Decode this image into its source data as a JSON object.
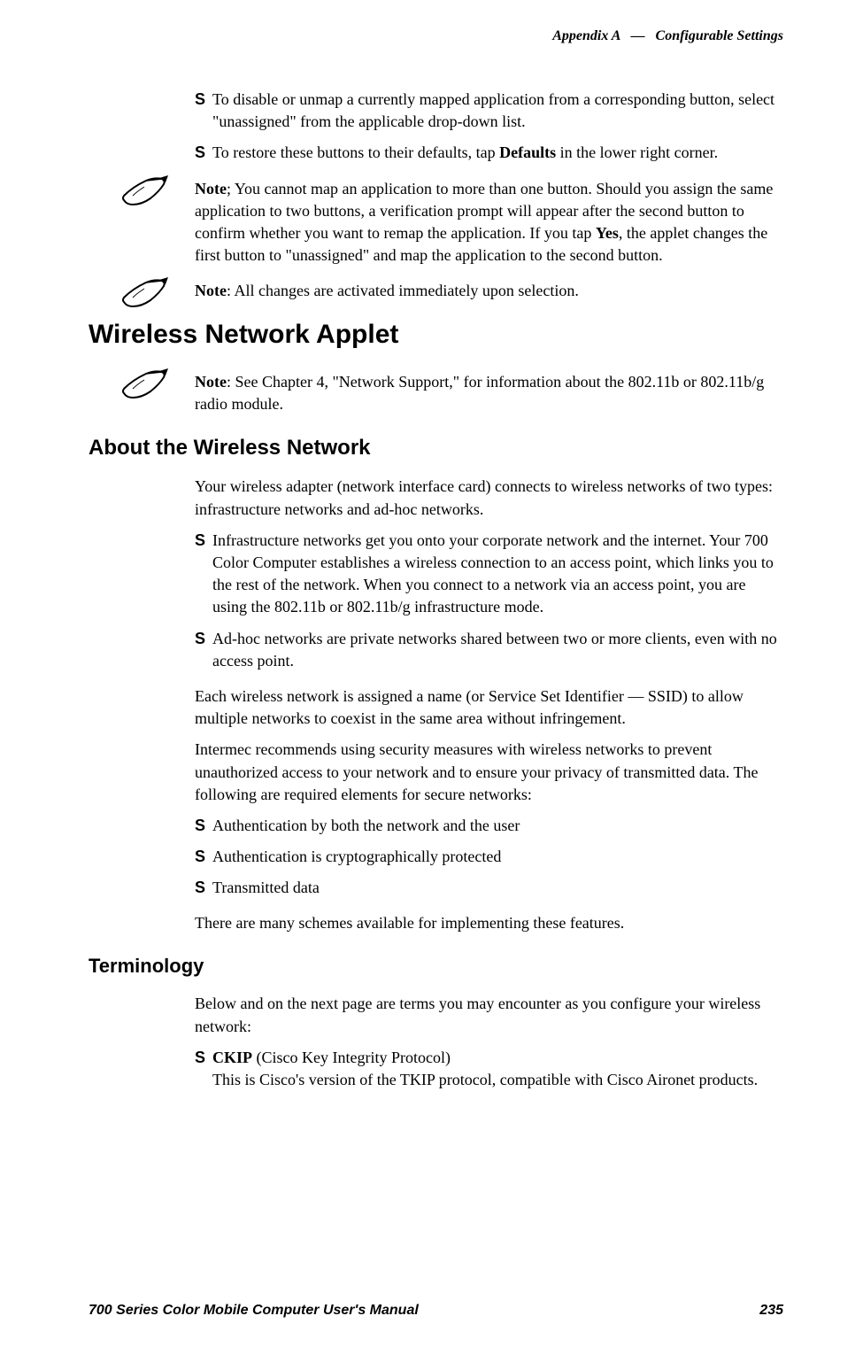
{
  "header": {
    "appendix": "Appendix A",
    "dash": "—",
    "title": "Configurable Settings"
  },
  "bullet1": "To disable or unmap a currently mapped application from a corresponding button, select \"unassigned\" from the applicable drop-down list.",
  "bullet2_before": "To restore these buttons to their defaults, tap ",
  "bullet2_bold": "Defaults",
  "bullet2_after": " in the lower right corner.",
  "note1_label": "Note",
  "note1_text": "; You cannot map an application to more than one button. Should you assign the same application to two buttons, a verification prompt will appear after the second button to confirm whether you want to remap the application. If you tap ",
  "note1_bold": "Yes",
  "note1_after": ", the applet changes the first button to \"unassigned\" and map the application to the second button.",
  "note2_label": "Note",
  "note2_text": ": All changes are activated immediately upon selection.",
  "h1": "Wireless Network Applet",
  "note3_label": "Note",
  "note3_text": ": See Chapter 4, \"Network Support,\" for information about the 802.11b or 802.11b/g radio module.",
  "h2": "About the Wireless Network",
  "p1": "Your wireless adapter (network interface card) connects to wireless networks of two types: infrastructure networks and ad-hoc networks.",
  "bullet3": "Infrastructure networks get you onto your corporate network and the internet. Your 700 Color Computer establishes a wireless connection to an access point, which links you to the rest of the network. When you connect to a network via an access point, you are using the 802.11b or 802.11b/g infrastructure mode.",
  "bullet4": "Ad-hoc networks are private networks shared between two or more clients, even with no access point.",
  "p2": "Each wireless network is assigned a name (or Service Set Identifier — SSID) to allow multiple networks to coexist in the same area without infringement.",
  "p3": "Intermec recommends using security measures with wireless networks to prevent unauthorized access to your network and to ensure your privacy of transmitted data. The following are required elements for secure networks:",
  "bullet5": "Authentication by both the network and the user",
  "bullet6": "Authentication is cryptographically protected",
  "bullet7": "Transmitted data",
  "p4": "There are many schemes available for implementing these features.",
  "h3": "Terminology",
  "p5": "Below and on the next page are terms you may encounter as you configure your wireless network:",
  "term1_bold": "CKIP",
  "term1_paren": " (Cisco Key Integrity Protocol)",
  "term1_desc": "This is Cisco's version of the TKIP protocol, compatible with Cisco Aironet products.",
  "footer": {
    "left": "700 Series Color Mobile Computer User's Manual",
    "right": "235"
  }
}
